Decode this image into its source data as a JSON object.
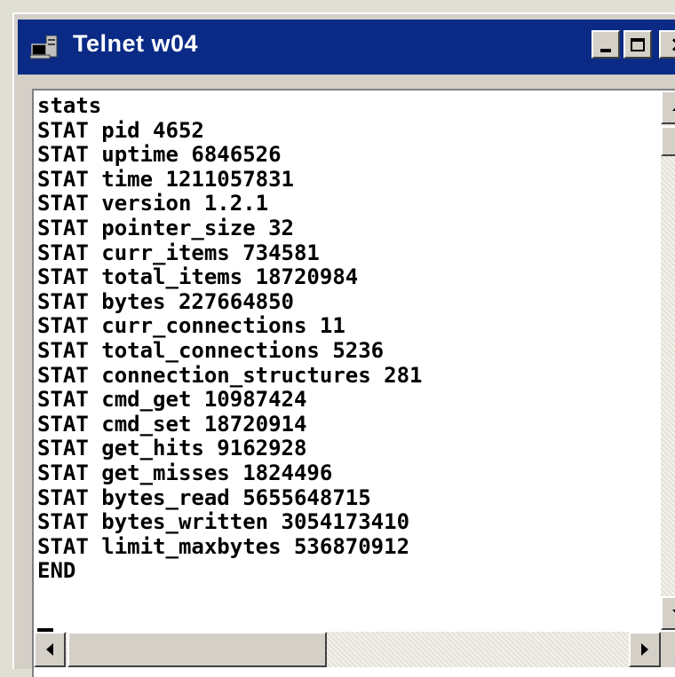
{
  "window": {
    "title": "Telnet w04",
    "title_bar_color": "#0a2a86",
    "icon": "telnet-computer-icon",
    "controls": [
      "minimize-icon",
      "maximize-icon",
      "close-icon"
    ]
  },
  "console": {
    "lines": [
      "stats",
      "STAT pid 4652",
      "STAT uptime 6846526",
      "STAT time 1211057831",
      "STAT version 1.2.1",
      "STAT pointer_size 32",
      "STAT curr_items 734581",
      "STAT total_items 18720984",
      "STAT bytes 227664850",
      "STAT curr_connections 11",
      "STAT total_connections 5236",
      "STAT connection_structures 281",
      "STAT cmd_get 10987424",
      "STAT cmd_set 18720914",
      "STAT get_hits 9162928",
      "STAT get_misses 1824496",
      "STAT bytes_read 5655648715",
      "STAT bytes_written 3054173410",
      "STAT limit_maxbytes 536870912",
      "END"
    ]
  },
  "scrollbars": {
    "vertical_position": 0.0,
    "horizontal_position": 0.0
  }
}
